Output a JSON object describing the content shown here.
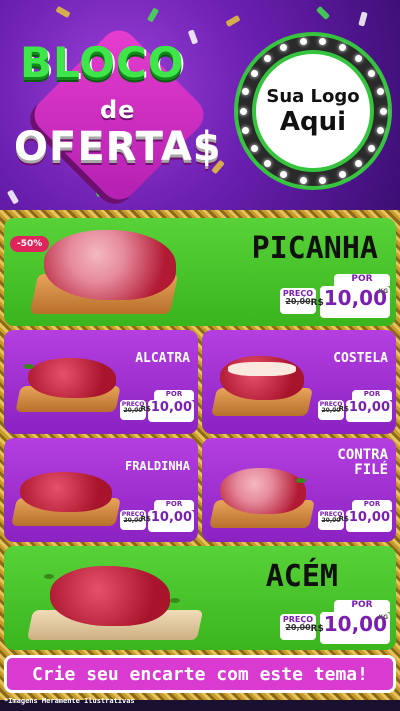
{
  "header": {
    "brand": {
      "line1": "BLOCO",
      "line2": "de",
      "line3": "OFERTA$"
    },
    "logo": {
      "line1": "Sua Logo",
      "line2": "Aqui"
    }
  },
  "products": [
    {
      "name": "PICANHA",
      "badge": "-50%",
      "por": "POR",
      "preco_label": "PREÇO",
      "old_price": "20,00",
      "currency": "R$",
      "new_price": "10,00",
      "unit": "KG"
    },
    {
      "name": "ALCATRA",
      "por": "POR",
      "preco_label": "PREÇO",
      "old_price": "20,00",
      "currency": "R$",
      "new_price": "10,00",
      "unit": "KG"
    },
    {
      "name": "COSTELA",
      "por": "POR",
      "preco_label": "PREÇO",
      "old_price": "20,00",
      "currency": "R$",
      "new_price": "10,00",
      "unit": "KG"
    },
    {
      "name": "FRALDINHA",
      "por": "POR",
      "preco_label": "PREÇO",
      "old_price": "20,00",
      "currency": "R$",
      "new_price": "10,00",
      "unit": "KG"
    },
    {
      "name_line1": "CONTRA",
      "name_line2": "FILÉ",
      "por": "POR",
      "preco_label": "PREÇO",
      "old_price": "20,00",
      "currency": "R$",
      "new_price": "10,00",
      "unit": "KG"
    },
    {
      "name": "ACÉM",
      "por": "POR",
      "preco_label": "PREÇO",
      "old_price": "20,00",
      "currency": "R$",
      "new_price": "10,00",
      "unit": "KG"
    }
  ],
  "banner": {
    "text": "Crie seu encarte com este tema!"
  },
  "footnote": "*Imagens Meramente Ilustrativas",
  "colors": {
    "green": "#4cc52a",
    "purple": "#9b2fd0",
    "pink": "#d93bd0",
    "price_text": "#7a1fb0"
  }
}
